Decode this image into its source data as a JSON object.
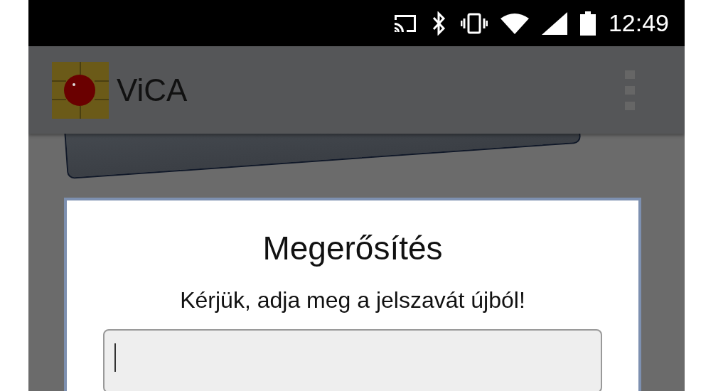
{
  "status_bar": {
    "time": "12:49"
  },
  "app_bar": {
    "title": "ViCA"
  },
  "dialog": {
    "title": "Megerősítés",
    "message": "Kérjük, adja meg a jelszavát újból!",
    "password_field": {
      "focused": true
    }
  }
}
